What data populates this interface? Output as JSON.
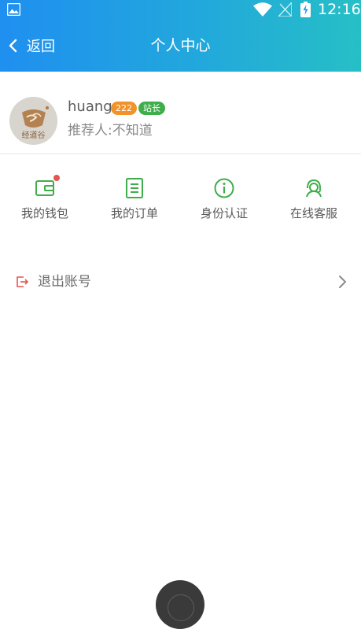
{
  "status_bar": {
    "time": "12:16",
    "icons": [
      "image-notification-icon",
      "wifi-icon",
      "no-signal-icon",
      "battery-charging-icon"
    ]
  },
  "header": {
    "back_label": "返回",
    "title": "个人中心",
    "gradient": [
      "#1f8ff0",
      "#26bfc6"
    ]
  },
  "profile": {
    "avatar_text": "经道谷",
    "username": "huang",
    "level_badge": "222",
    "role_badge": "站长",
    "referrer": "推荐人:不知道"
  },
  "menu": {
    "items": [
      {
        "label": "我的钱包",
        "icon": "wallet-icon",
        "has_dot": true
      },
      {
        "label": "我的订单",
        "icon": "order-list-icon",
        "has_dot": false
      },
      {
        "label": "身份认证",
        "icon": "info-circle-icon",
        "has_dot": false
      },
      {
        "label": "在线客服",
        "icon": "customer-service-icon",
        "has_dot": false
      }
    ],
    "accent_color": "#3fae4a"
  },
  "logout": {
    "label": "退出账号",
    "icon_color": "#e8534f"
  }
}
